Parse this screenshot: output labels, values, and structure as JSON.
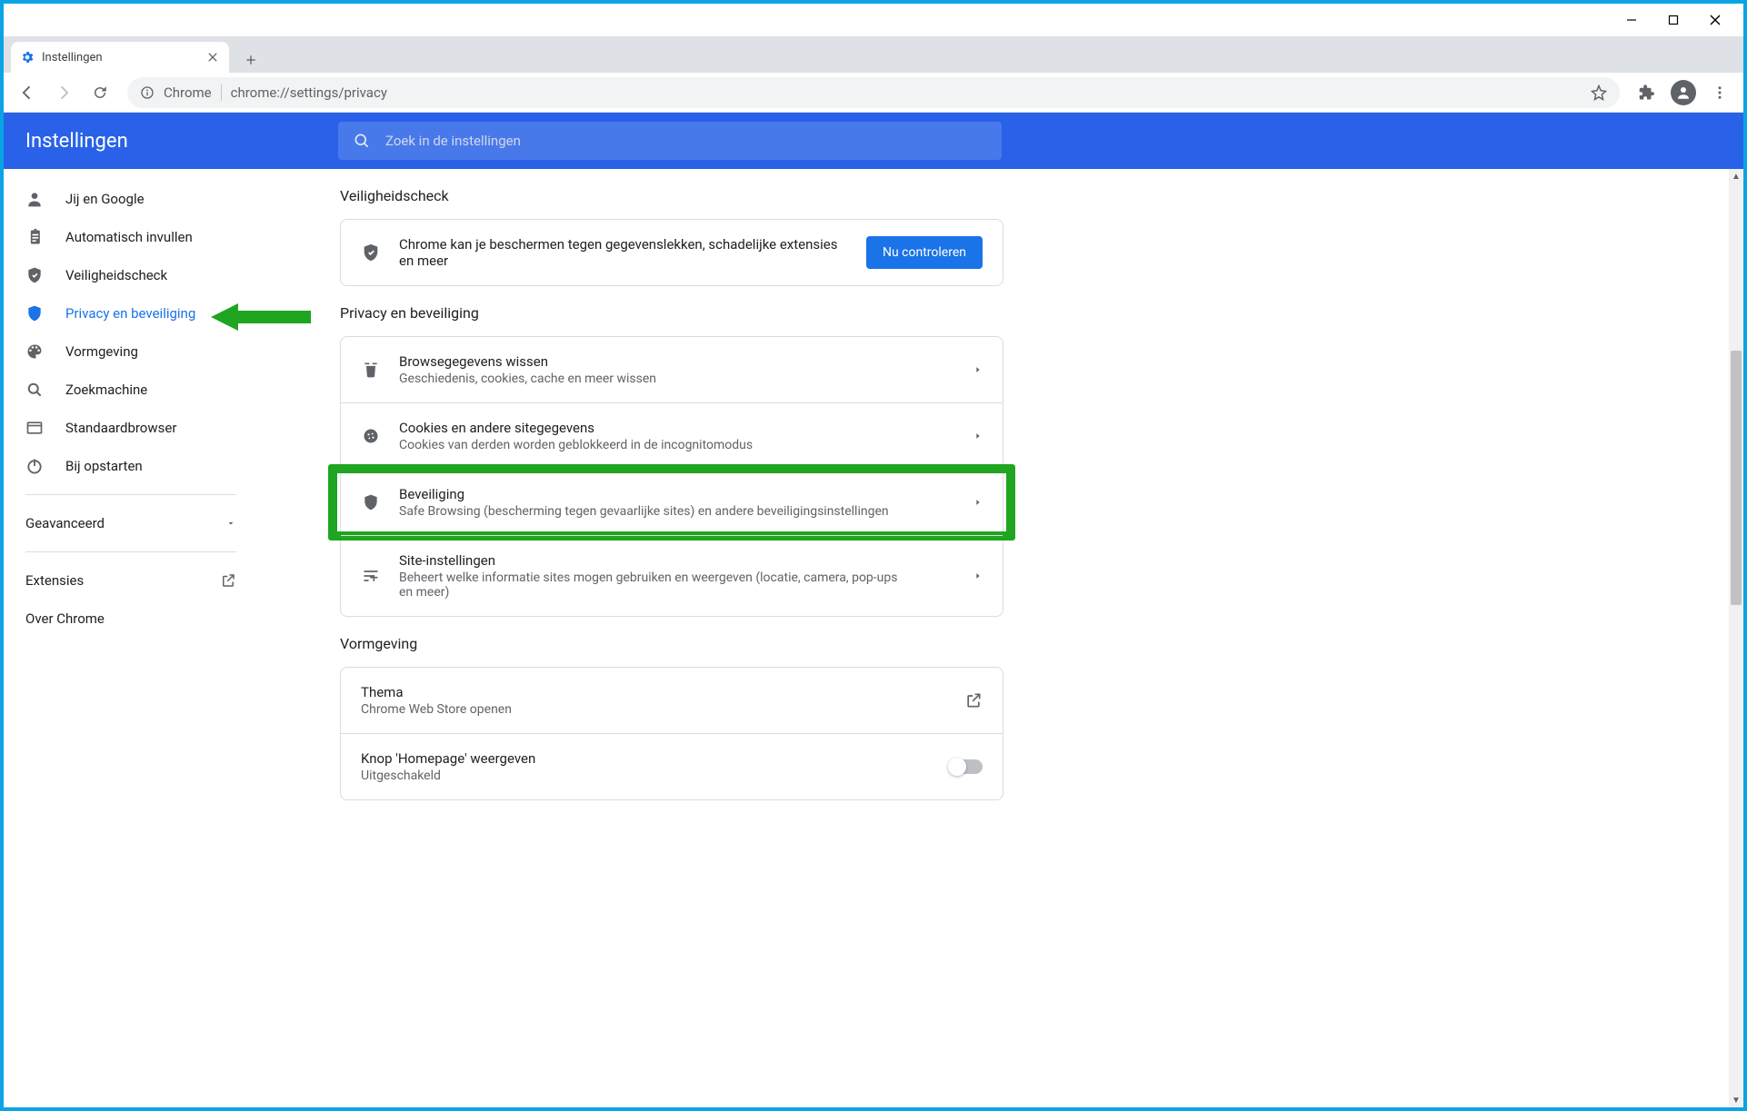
{
  "window": {
    "tab_title": "Instellingen"
  },
  "toolbar": {
    "chip": "Chrome",
    "url": "chrome://settings/privacy"
  },
  "header": {
    "title": "Instellingen",
    "search_placeholder": "Zoek in de instellingen"
  },
  "sidebar": {
    "items": [
      {
        "label": "Jij en Google"
      },
      {
        "label": "Automatisch invullen"
      },
      {
        "label": "Veiligheidscheck"
      },
      {
        "label": "Privacy en beveiliging"
      },
      {
        "label": "Vormgeving"
      },
      {
        "label": "Zoekmachine"
      },
      {
        "label": "Standaardbrowser"
      },
      {
        "label": "Bij opstarten"
      }
    ],
    "advanced": "Geavanceerd",
    "extensions": "Extensies",
    "about": "Over Chrome"
  },
  "sections": {
    "safety": {
      "title": "Veiligheidscheck",
      "desc": "Chrome kan je beschermen tegen gegevenslekken, schadelijke extensies en meer",
      "button": "Nu controleren"
    },
    "privacy": {
      "title": "Privacy en beveiliging",
      "rows": [
        {
          "title": "Browsegegevens wissen",
          "sub": "Geschiedenis, cookies, cache en meer wissen"
        },
        {
          "title": "Cookies en andere sitegegevens",
          "sub": "Cookies van derden worden geblokkeerd in de incognitomodus"
        },
        {
          "title": "Beveiliging",
          "sub": "Safe Browsing (bescherming tegen gevaarlijke sites) en andere beveiligingsinstellingen"
        },
        {
          "title": "Site-instellingen",
          "sub": "Beheert welke informatie sites mogen gebruiken en weergeven (locatie, camera, pop-ups en meer)"
        }
      ]
    },
    "appearance": {
      "title": "Vormgeving",
      "rows": [
        {
          "title": "Thema",
          "sub": "Chrome Web Store openen"
        },
        {
          "title": "Knop 'Homepage' weergeven",
          "sub": "Uitgeschakeld"
        }
      ]
    }
  }
}
